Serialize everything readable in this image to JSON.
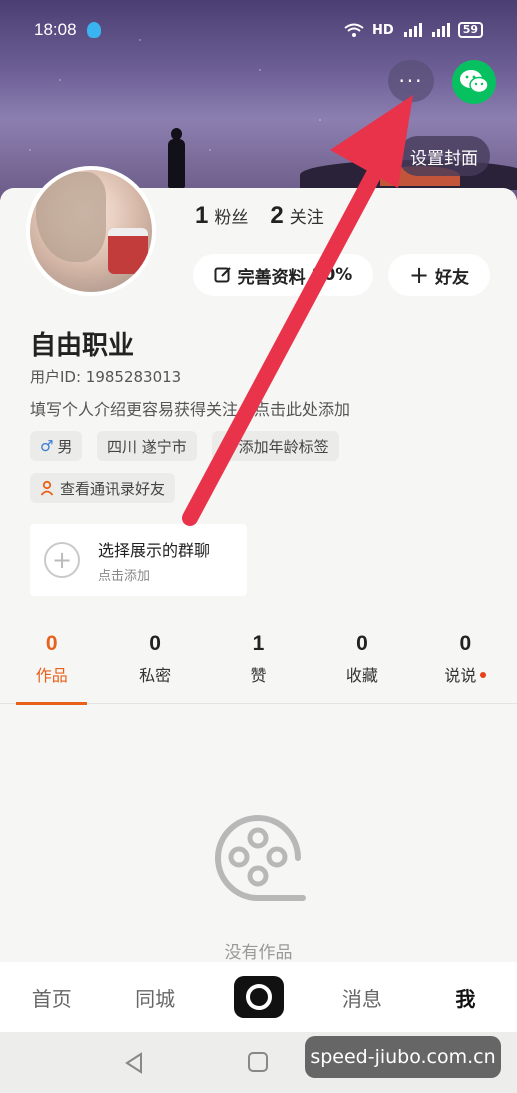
{
  "status_bar": {
    "time": "18:08",
    "network": "HD",
    "battery": "59"
  },
  "header": {
    "more_label": "···",
    "set_cover_label": "设置封面"
  },
  "profile": {
    "fans_count": "1",
    "fans_label": "粉丝",
    "following_count": "2",
    "following_label": "关注",
    "complete_label": "完善资料",
    "complete_percent": "80%",
    "friend_label": "好友",
    "name": "自由职业",
    "user_id": "用户ID: 1985283013",
    "bio": "填写个人介绍更容易获得关注，点击此处添加",
    "tags": {
      "gender": "男",
      "region": "四川 遂宁市",
      "age": "添加年龄标签",
      "contacts": "查看通讯录好友"
    }
  },
  "group_chat": {
    "title": "选择展示的群聊",
    "subtitle": "点击添加"
  },
  "tabs": [
    {
      "count": "0",
      "label": "作品"
    },
    {
      "count": "0",
      "label": "私密"
    },
    {
      "count": "1",
      "label": "赞"
    },
    {
      "count": "0",
      "label": "收藏"
    },
    {
      "count": "0",
      "label": "说说"
    }
  ],
  "empty_state": {
    "text": "没有作品"
  },
  "bottom_nav": {
    "home": "首页",
    "local": "同城",
    "messages": "消息",
    "me": "我"
  },
  "watermark": "speed-jiubo.com.cn",
  "colors": {
    "accent": "#e8611a",
    "arrow": "#e8334a",
    "wechat": "#07c160"
  }
}
